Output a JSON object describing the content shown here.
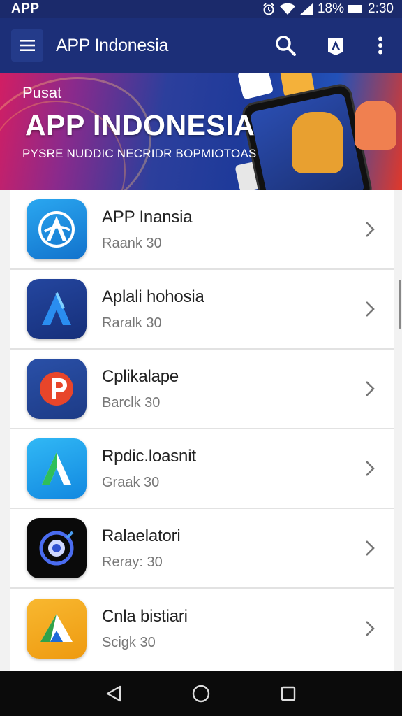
{
  "status_bar": {
    "app_label": "APP",
    "battery": "18%",
    "time": "2:30",
    "icons": [
      "alarm-icon",
      "wifi-icon",
      "signal-icon",
      "battery-icon"
    ]
  },
  "toolbar": {
    "title": "APP Indonesia",
    "icons": [
      "menu-icon",
      "search-icon",
      "app-store-icon",
      "more-vert-icon"
    ]
  },
  "banner": {
    "kicker": "Pusat",
    "headline": "APP INDONESIA",
    "subline": "PYSRE NUDDIC NECRIDR BOPMIOTOAS"
  },
  "apps": [
    {
      "name": "APP Inansia",
      "rank": "Raank 30",
      "icon": "app-inansia-logo-icon",
      "color": "#1e8fe0"
    },
    {
      "name": "Aplali hohosia",
      "rank": "Raralk 30",
      "icon": "letter-a-logo-icon",
      "color": "#1f3f9a"
    },
    {
      "name": "Cplikalape",
      "rank": "Barclk 30",
      "icon": "letter-p-logo-icon",
      "color": "#25489e"
    },
    {
      "name": "Rpdic.loasnit",
      "rank": "Graak 30",
      "icon": "letter-a-green-logo-icon",
      "color": "#1aa0ea"
    },
    {
      "name": "Ralaelatori",
      "rank": "Reray: 30",
      "icon": "orbit-logo-icon",
      "color": "#0a0a0a"
    },
    {
      "name": "Cnla bistiari",
      "rank": "Scigk 30",
      "icon": "triangle-logo-icon",
      "color": "#f2a418"
    }
  ],
  "nav_bar": {
    "icons": [
      "back-icon",
      "home-icon",
      "recents-icon"
    ]
  }
}
